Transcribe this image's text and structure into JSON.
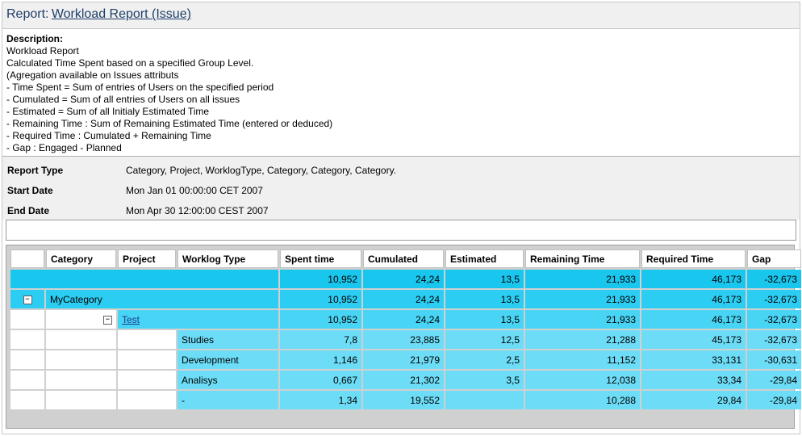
{
  "header": {
    "prefix": "Report:",
    "title": "Workload Report (Issue)"
  },
  "description": {
    "heading": "Description:",
    "lines": [
      "Workload Report",
      "Calculated Time Spent based on a specified Group Level.",
      "(Agregation available on Issues attributs",
      "- Time Spent = Sum of entries of Users on the specified period",
      "- Cumulated = Sum of all entries of Users on all issues",
      "- Estimated = Sum of all Initialy Estimated Time",
      "- Remaining Time : Sum of Remaining Estimated Time (entered or deduced)",
      "- Required Time : Cumulated + Remaining Time",
      "- Gap : Engaged - Planned"
    ]
  },
  "info": {
    "report_type_label": "Report Type",
    "report_type_value": "Category, Project, WorklogType, Category, Category, Category.",
    "start_date_label": "Start Date",
    "start_date_value": "Mon Jan 01 00:00:00 CET 2007",
    "end_date_label": "End Date",
    "end_date_value": "Mon Apr 30 12:00:00 CEST 2007"
  },
  "columns": [
    "",
    "Category",
    "Project",
    "Worklog Type",
    "Spent time",
    "Cumulated",
    "Estimated",
    "Remaining Time",
    "Required Time",
    "Gap"
  ],
  "toggle_symbol": "⊟",
  "rows": {
    "total": {
      "spent": "10,952",
      "cumulated": "24,24",
      "estimated": "13,5",
      "remaining": "21,933",
      "required": "46,173",
      "gap": "-32,673"
    },
    "category": {
      "name": "MyCategory",
      "spent": "10,952",
      "cumulated": "24,24",
      "estimated": "13,5",
      "remaining": "21,933",
      "required": "46,173",
      "gap": "-32,673"
    },
    "project": {
      "name": "Test",
      "spent": "10,952",
      "cumulated": "24,24",
      "estimated": "13,5",
      "remaining": "21,933",
      "required": "46,173",
      "gap": "-32,673"
    },
    "worklogs": [
      {
        "type": "Studies",
        "spent": "7,8",
        "cumulated": "23,885",
        "estimated": "12,5",
        "remaining": "21,288",
        "required": "45,173",
        "gap": "-32,673"
      },
      {
        "type": "Development",
        "spent": "1,146",
        "cumulated": "21,979",
        "estimated": "2,5",
        "remaining": "11,152",
        "required": "33,131",
        "gap": "-30,631"
      },
      {
        "type": "Analisys",
        "spent": "0,667",
        "cumulated": "21,302",
        "estimated": "3,5",
        "remaining": "12,038",
        "required": "33,34",
        "gap": "-29,84"
      },
      {
        "type": "-",
        "spent": "1,34",
        "cumulated": "19,552",
        "estimated": "",
        "remaining": "10,288",
        "required": "29,84",
        "gap": "-29,84"
      }
    ]
  }
}
